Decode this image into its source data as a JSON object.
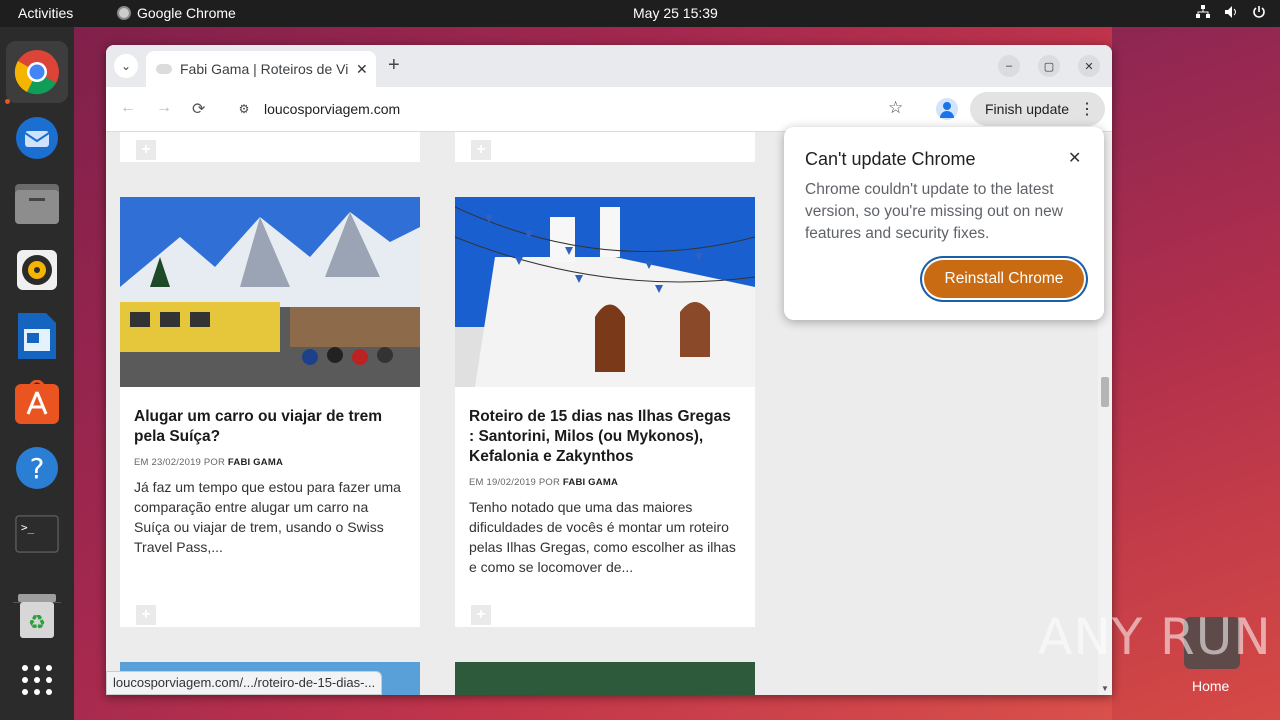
{
  "topbar": {
    "activities": "Activities",
    "app_name": "Google Chrome",
    "clock": "May 25  15:39"
  },
  "dock": {
    "items": [
      "chrome-icon",
      "thunderbird-icon",
      "files-icon",
      "rhythmbox-icon",
      "libreoffice-writer-icon",
      "app-center-icon",
      "help-icon",
      "terminal-icon",
      "trash-icon",
      "show-apps-icon"
    ]
  },
  "browser": {
    "tab_title": "Fabi Gama | Roteiros de Viagem",
    "url": "loucosporviagem.com",
    "update_button": "Finish update",
    "status_url": "loucosporviagem.com/.../roteiro-de-15-dias-..."
  },
  "page": {
    "cards": [
      {
        "title": "Alugar um carro ou viajar de trem pela Suíça?",
        "meta_prefix": "EM 23/02/2019 POR",
        "author": "FABI GAMA",
        "excerpt": "Já faz um tempo que estou para fazer uma comparação entre alugar um carro na Suíça ou viajar de trem, usando o Swiss Travel Pass,..."
      },
      {
        "title": "Roteiro de 15 dias nas Ilhas Gregas : Santorini, Milos (ou Mykonos), Kefalonia e Zakynthos",
        "meta_prefix": "EM 19/02/2019 POR",
        "author": "FABI GAMA",
        "excerpt": "Tenho notado que uma das maiores dificuldades de vocês é montar um roteiro pelas Ilhas Gregas, como escolher as ilhas e como se locomover de..."
      }
    ]
  },
  "popup": {
    "title": "Can't update Chrome",
    "body": "Chrome couldn't update to the latest version, so you're missing out on new features and security fixes.",
    "button": "Reinstall Chrome"
  },
  "desktop": {
    "home_label": "Home",
    "watermark": "ANY RUN"
  },
  "colors": {
    "reinstall_button": "#c96b12",
    "ubuntu_accent": "#e95420"
  }
}
